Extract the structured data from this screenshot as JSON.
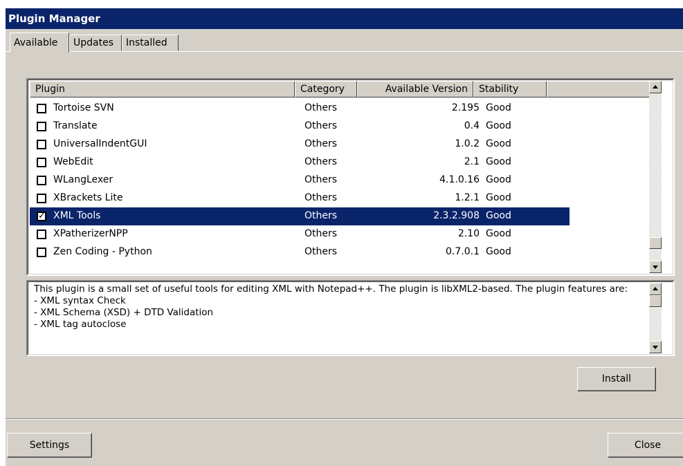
{
  "window": {
    "title": "Plugin Manager"
  },
  "tabs": [
    {
      "label": "Available",
      "active": true
    },
    {
      "label": "Updates",
      "active": false
    },
    {
      "label": "Installed",
      "active": false
    }
  ],
  "table": {
    "columns": [
      "Plugin",
      "Category",
      "Available Version",
      "Stability"
    ],
    "rows": [
      {
        "name": "Tortoise SVN",
        "category": "Others",
        "version": "2.195",
        "stability": "Good",
        "checked": false,
        "selected": false
      },
      {
        "name": "Translate",
        "category": "Others",
        "version": "0.4",
        "stability": "Good",
        "checked": false,
        "selected": false
      },
      {
        "name": "UniversalIndentGUI",
        "category": "Others",
        "version": "1.0.2",
        "stability": "Good",
        "checked": false,
        "selected": false
      },
      {
        "name": "WebEdit",
        "category": "Others",
        "version": "2.1",
        "stability": "Good",
        "checked": false,
        "selected": false
      },
      {
        "name": "WLangLexer",
        "category": "Others",
        "version": "4.1.0.16",
        "stability": "Good",
        "checked": false,
        "selected": false
      },
      {
        "name": "XBrackets Lite",
        "category": "Others",
        "version": "1.2.1",
        "stability": "Good",
        "checked": false,
        "selected": false
      },
      {
        "name": "XML Tools",
        "category": "Others",
        "version": "2.3.2.908",
        "stability": "Good",
        "checked": true,
        "selected": true
      },
      {
        "name": "XPatherizerNPP",
        "category": "Others",
        "version": "2.10",
        "stability": "Good",
        "checked": false,
        "selected": false
      },
      {
        "name": "Zen Coding - Python",
        "category": "Others",
        "version": "0.7.0.1",
        "stability": "Good",
        "checked": false,
        "selected": false
      }
    ]
  },
  "description": {
    "text": "This plugin is a small set of useful tools for editing XML with Notepad++. The plugin is libXML2-based. The plugin features are:\n- XML syntax Check\n- XML Schema (XSD) + DTD Validation\n- XML tag autoclose"
  },
  "buttons": {
    "install": "Install",
    "settings": "Settings",
    "close": "Close"
  }
}
